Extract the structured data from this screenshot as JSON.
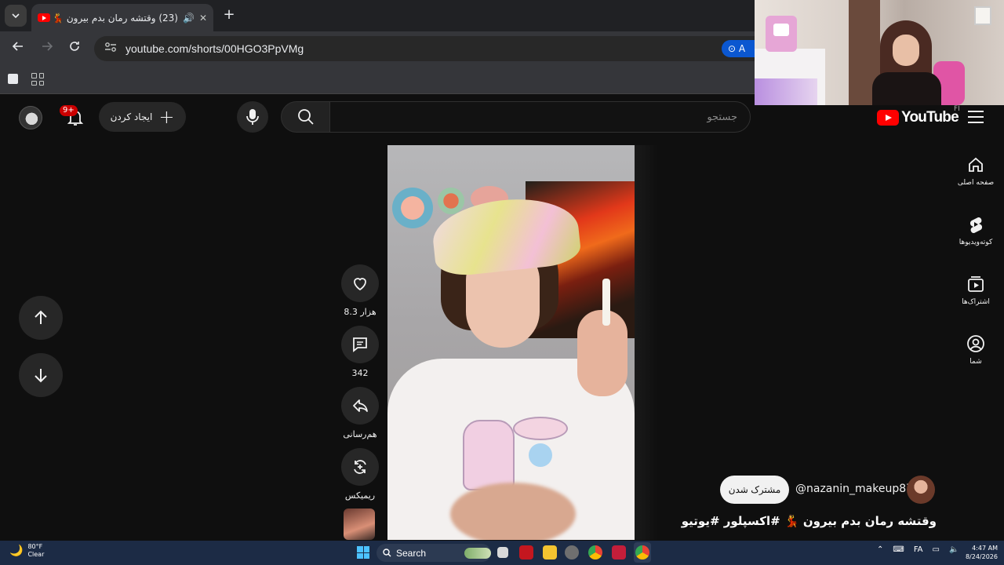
{
  "browser": {
    "tab_title": "(23) وقتشه رمان بدم بیرون 💃",
    "url": "youtube.com/shorts/00HGO3PpVMg",
    "lens_chip": "A"
  },
  "youtube": {
    "logo_text": "YouTube",
    "country_code": "FI",
    "search_placeholder": "جستجو",
    "create_label": "ایجاد کردن",
    "notifications_badge": "9+",
    "rail": [
      {
        "label": "صفحه اصلی",
        "icon": "home-icon"
      },
      {
        "label": "کوته‌ویدیوها",
        "icon": "shorts-icon"
      },
      {
        "label": "اشتراک‌ها",
        "icon": "subscriptions-icon"
      },
      {
        "label": "شما",
        "icon": "you-icon"
      }
    ],
    "actions": {
      "like_count": "8.3 هزار",
      "comment_count": "342",
      "share_label": "هم‌رسانی",
      "remix_label": "ریمیکس"
    },
    "channel": {
      "handle": "@nazanin_makeup87",
      "subscribe_label": "مشترک شدن"
    },
    "short_title": "وقتشه رمان بدم بیرون 💃 #اکسپلور #یوتیوب ..."
  },
  "taskbar": {
    "weather_temp": "80°F",
    "weather_desc": "Clear",
    "search_label": "Search",
    "lang": "FA",
    "time": "4:47 AM",
    "date": "8/24/2026"
  },
  "colors": {
    "youtube_red": "#ff0000",
    "page_bg": "#0f0f0f",
    "taskbar_bg": "#1c2b45"
  }
}
